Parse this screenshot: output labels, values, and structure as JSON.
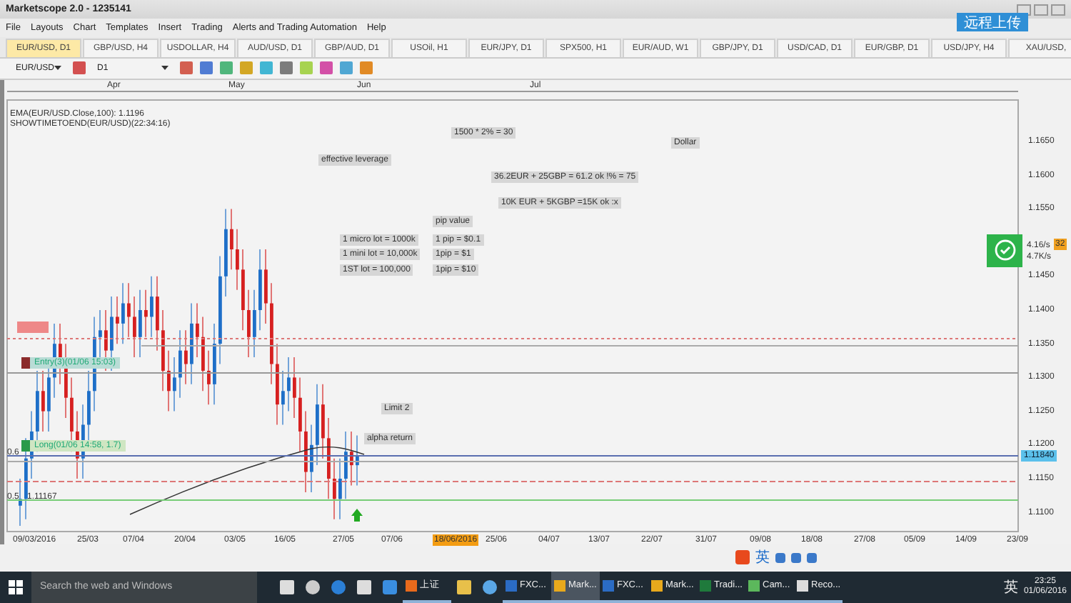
{
  "window": {
    "title": "Marketscope 2.0 - 1235141",
    "upload_button": "远程上传"
  },
  "menu": [
    "File",
    "Layouts",
    "Chart",
    "Templates",
    "Insert",
    "Trading",
    "Alerts and Trading Automation",
    "Help"
  ],
  "tabs": [
    {
      "label": "EUR/USD, D1",
      "selected": true
    },
    {
      "label": "GBP/USD, H4",
      "selected": false
    },
    {
      "label": "USDOLLAR, H4",
      "selected": false
    },
    {
      "label": "AUD/USD, D1",
      "selected": false
    },
    {
      "label": "GBP/AUD, D1",
      "selected": false
    },
    {
      "label": "USOil, H1",
      "selected": false
    },
    {
      "label": "EUR/JPY, D1",
      "selected": false
    },
    {
      "label": "SPX500, H1",
      "selected": false
    },
    {
      "label": "EUR/AUD, W1",
      "selected": false
    },
    {
      "label": "GBP/JPY, D1",
      "selected": false
    },
    {
      "label": "USD/CAD, D1",
      "selected": false
    },
    {
      "label": "EUR/GBP, D1",
      "selected": false
    },
    {
      "label": "USD/JPY, H4",
      "selected": false
    },
    {
      "label": "XAU/USD,",
      "selected": false
    }
  ],
  "toolbar": {
    "symbol": "EUR/USD",
    "timeframe": "D1"
  },
  "chart": {
    "months": [
      "Apr",
      "May",
      "Jun",
      "Jul"
    ],
    "indicators": [
      "EMA(EUR/USD.Close,100): 1.1196",
      "SHOWTIMETOEND(EUR/USD)(22:34:16)"
    ],
    "notes": [
      "1500 * 2% = 30",
      "Dollar",
      "effective leverage",
      "36.2EUR + 25GBP = 61.2 ok !% = 75",
      "10K EUR + 5KGBP =15K ok :x",
      "pip value",
      "1 micro lot = 1000k",
      "1 pip = $0.1",
      "1 mini lot = 10,000k",
      "1pip = $1",
      "1ST lot = 100,000",
      "1pip = $10",
      "Limit 2",
      "alpha return"
    ],
    "orders": [
      {
        "label": "Entry(3)(01/06 15:03)",
        "kind": "entry"
      },
      {
        "label": "Long(01/06 14:58, 1.7)",
        "kind": "long"
      }
    ],
    "fib_labels": [
      "0.6",
      "0.5",
      "1.11167"
    ],
    "price_ticks": [
      "1.1650",
      "1.1600",
      "1.1550",
      "1.1450",
      "1.1400",
      "1.1350",
      "1.1300",
      "1.1250",
      "1.1200",
      "1.1150",
      "1.1100"
    ],
    "current_price": "1.11840",
    "speed": {
      "up": "4.16/s",
      "down": "4.7K/s",
      "badge": "32"
    },
    "dates": [
      {
        "label": "09/03/2016",
        "selected": false
      },
      {
        "label": "25/03",
        "selected": false
      },
      {
        "label": "07/04",
        "selected": false
      },
      {
        "label": "20/04",
        "selected": false
      },
      {
        "label": "03/05",
        "selected": false
      },
      {
        "label": "16/05",
        "selected": false
      },
      {
        "label": "27/05",
        "selected": false
      },
      {
        "label": "07/06",
        "selected": false
      },
      {
        "label": "18/06/2016",
        "selected": true
      },
      {
        "label": "25/06",
        "selected": false
      },
      {
        "label": "04/07",
        "selected": false
      },
      {
        "label": "13/07",
        "selected": false
      },
      {
        "label": "22/07",
        "selected": false
      },
      {
        "label": "31/07",
        "selected": false
      },
      {
        "label": "09/08",
        "selected": false
      },
      {
        "label": "18/08",
        "selected": false
      },
      {
        "label": "27/08",
        "selected": false
      },
      {
        "label": "05/09",
        "selected": false
      },
      {
        "label": "14/09",
        "selected": false
      },
      {
        "label": "23/09",
        "selected": false
      }
    ]
  },
  "ime_bar": {
    "language": "英"
  },
  "taskbar": {
    "search": {
      "placeholder": "Search the web and Windows"
    },
    "apps": [
      {
        "label": "上证",
        "selected": false
      },
      {
        "label": "FXC...",
        "selected": false
      },
      {
        "label": "Mark...",
        "selected": true
      },
      {
        "label": "FXC...",
        "selected": false
      },
      {
        "label": "Mark...",
        "selected": false
      },
      {
        "label": "Tradi...",
        "selected": false
      },
      {
        "label": "Cam...",
        "selected": false
      },
      {
        "label": "Reco...",
        "selected": false
      }
    ],
    "language": "英",
    "time": "23:25",
    "date": "01/06/2016"
  }
}
